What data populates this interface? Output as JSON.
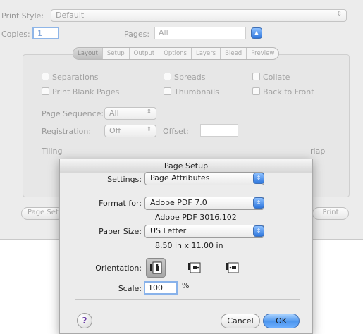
{
  "print_dialog": {
    "print_style_label": "Print Style:",
    "print_style_value": "Default",
    "copies_label": "Copies:",
    "copies_value": "1",
    "pages_label": "Pages:",
    "pages_value": "All",
    "tabs": [
      "Layout",
      "Setup",
      "Output",
      "Options",
      "Layers",
      "Bleed",
      "Preview"
    ],
    "active_tab": "Layout",
    "checkboxes": {
      "separations": "Separations",
      "print_blank_pages": "Print Blank Pages",
      "spreads": "Spreads",
      "thumbnails": "Thumbnails",
      "collate": "Collate",
      "back_to_front": "Back to Front"
    },
    "page_sequence_label": "Page Sequence:",
    "page_sequence_value": "All",
    "registration_label": "Registration:",
    "registration_value": "Off",
    "offset_label": "Offset:",
    "tiling_label_partial": "Tiling",
    "overlap_partial": "rlap",
    "page_setup_button_partial": "Page Set",
    "print_button": "Print"
  },
  "page_setup": {
    "title": "Page Setup",
    "settings_label": "Settings:",
    "settings_value": "Page Attributes",
    "format_for_label": "Format for:",
    "format_for_value": "Adobe PDF 7.0",
    "format_for_subtext": "Adobe PDF 3016.102",
    "paper_size_label": "Paper Size:",
    "paper_size_value": "US Letter",
    "paper_size_subtext": "8.50 in x 11.00 in",
    "orientation_label": "Orientation:",
    "scale_label": "Scale:",
    "scale_value": "100",
    "scale_unit": "%",
    "help_symbol": "?",
    "cancel_button": "Cancel",
    "ok_button": "OK"
  },
  "icons": {
    "stepper": "up-down-arrows-icon",
    "orientation_portrait": "portrait-orientation-icon",
    "orientation_landscape": "landscape-orientation-icon",
    "orientation_landscape_reverse": "reverse-landscape-orientation-icon",
    "help": "help-icon"
  },
  "colors": {
    "accent_blue": "#3f86e6",
    "dialog_bg": "#ececec"
  }
}
